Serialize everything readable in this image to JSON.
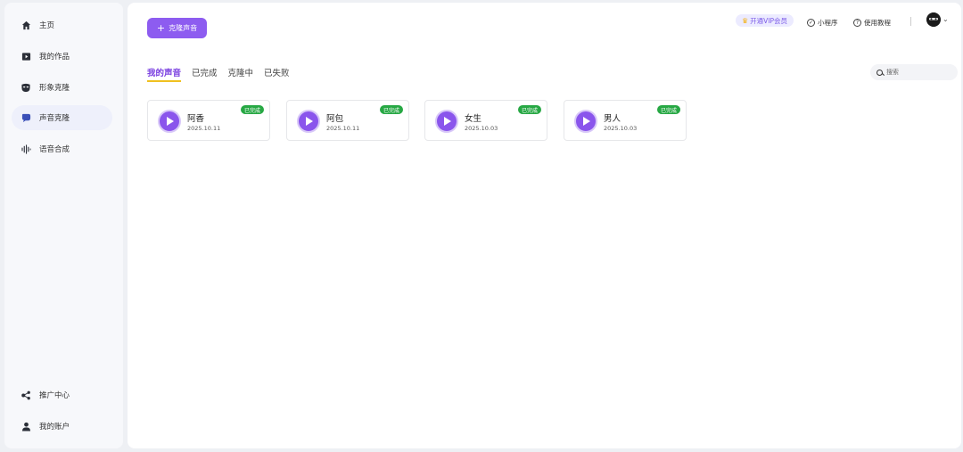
{
  "sidebar": {
    "items": [
      {
        "label": "主页",
        "icon": "home-icon"
      },
      {
        "label": "我的作品",
        "icon": "video-icon"
      },
      {
        "label": "形象克隆",
        "icon": "mask-icon"
      },
      {
        "label": "声音克隆",
        "icon": "speech-bubble-icon",
        "active": true
      },
      {
        "label": "语音合成",
        "icon": "sound-wave-icon"
      }
    ],
    "bottom_items": [
      {
        "label": "推广中心",
        "icon": "share-icon"
      },
      {
        "label": "我的账户",
        "icon": "user-icon"
      }
    ]
  },
  "header": {
    "clone_button": "克隆声音",
    "vip_label": "开通VIP会员",
    "mini_program": "小程序",
    "tutorial": "使用教程"
  },
  "tabs": [
    {
      "label": "我的声音",
      "active": true
    },
    {
      "label": "已完成"
    },
    {
      "label": "克隆中"
    },
    {
      "label": "已失败"
    }
  ],
  "search": {
    "placeholder": "搜索"
  },
  "voices": [
    {
      "name": "阿香",
      "date": "2025.10.11",
      "status": "已完成"
    },
    {
      "name": "阿包",
      "date": "2025.10.11",
      "status": "已完成"
    },
    {
      "name": "女生",
      "date": "2025.10.03",
      "status": "已完成"
    },
    {
      "name": "男人",
      "date": "2025.10.03",
      "status": "已完成"
    }
  ],
  "colors": {
    "accent": "#8d5cf0",
    "status_done": "#27a844",
    "tab_underline": "#f0c020"
  }
}
